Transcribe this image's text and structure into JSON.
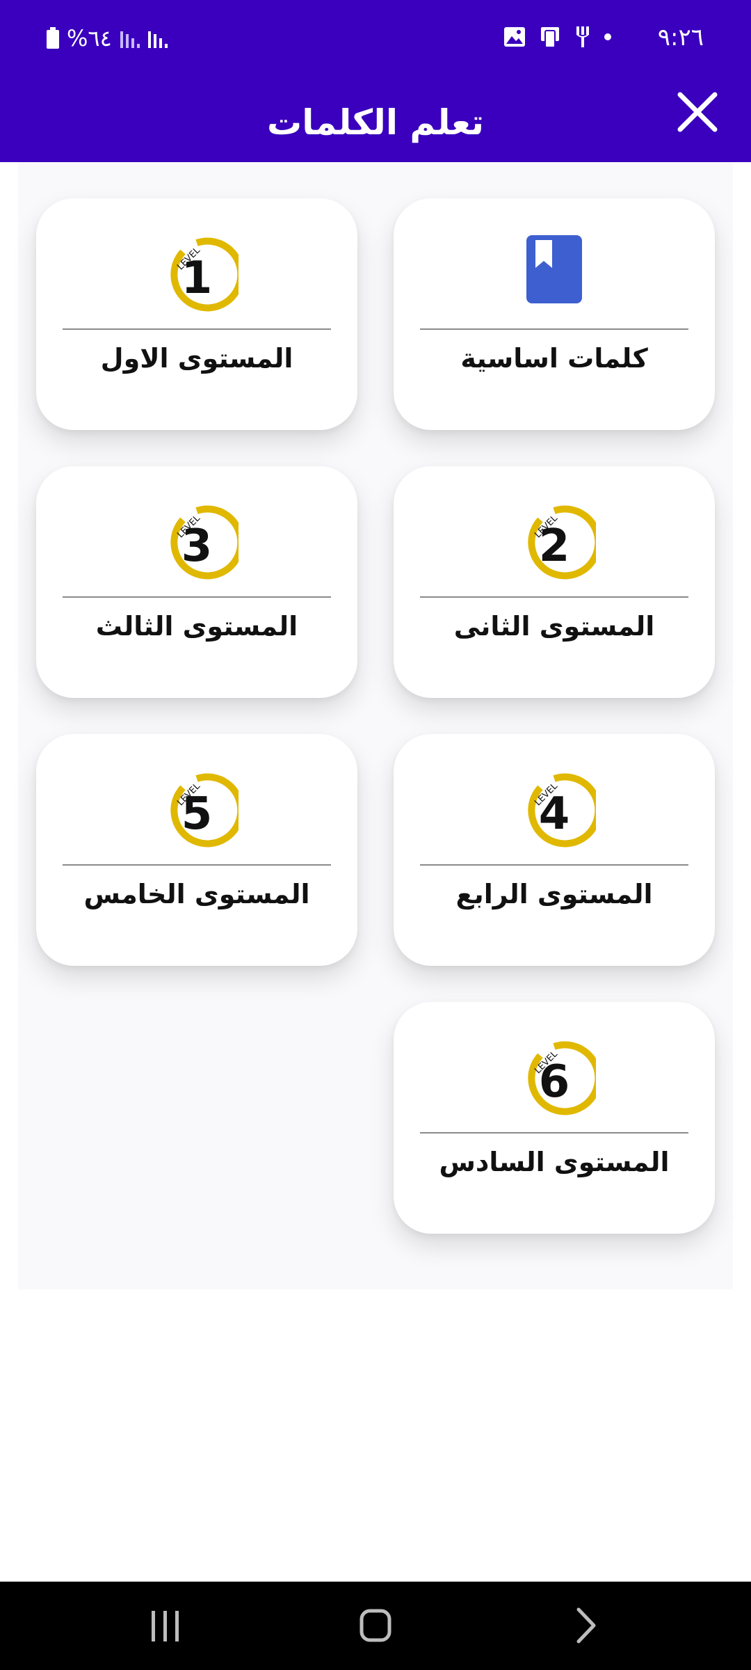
{
  "status": {
    "time": "٩:٢٦",
    "battery": "%٦٤"
  },
  "header": {
    "title": "تعلم الكلمات"
  },
  "cards": [
    {
      "label": "كلمات اساسية",
      "icon": "bookmark-icon",
      "color": "#3d5fcf"
    },
    {
      "label": "المستوى الاول",
      "level": "1",
      "badge_text": "LEVEL",
      "ring_color": "#e0b800"
    },
    {
      "label": "المستوى الثانى",
      "level": "2",
      "badge_text": "LEVEL",
      "ring_color": "#e0b800"
    },
    {
      "label": "المستوى الثالث",
      "level": "3",
      "badge_text": "LEVEL",
      "ring_color": "#e0b800"
    },
    {
      "label": "المستوى الرابع",
      "level": "4",
      "badge_text": "LEVEL",
      "ring_color": "#e0b800"
    },
    {
      "label": "المستوى الخامس",
      "level": "5",
      "badge_text": "LEVEL",
      "ring_color": "#e0b800"
    },
    {
      "label": "المستوى السادس",
      "level": "6",
      "badge_text": "LEVEL",
      "ring_color": "#e0b800"
    }
  ],
  "colors": {
    "header_bg": "#3a00bd",
    "nav_bg": "#000000"
  },
  "navigation": {
    "icons": [
      "recent-apps-icon",
      "home-icon",
      "back-icon"
    ]
  }
}
